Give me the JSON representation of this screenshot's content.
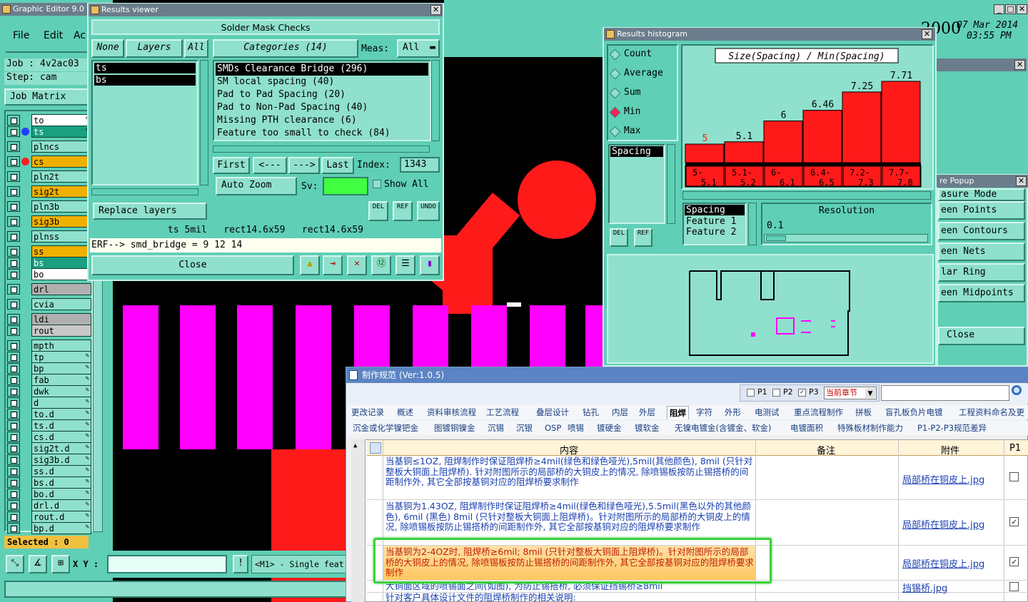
{
  "editor": {
    "title": "Graphic Editor 9.0",
    "menu": [
      "File",
      "Edit",
      "Ac"
    ],
    "job": "Job : 4v2ac03",
    "step": "Step: cam",
    "job_matrix": "Job Matrix ...",
    "selected": "Selected : 0",
    "xy_label": "X Y :",
    "msg": "<M1> - Single feat",
    "date": "07 Mar 2014",
    "time": "03:55 PM",
    "sheet_partial": "2000"
  },
  "layers": [
    "to",
    "ts",
    "plncs",
    "cs",
    "pln2t",
    "sig2t",
    "pln3b",
    "sig3b",
    "plnss",
    "ss",
    "bs",
    "bo",
    "drl",
    "cvia",
    "ldi",
    "rout",
    "mpth",
    "tp",
    "bp",
    "fab",
    "dwk",
    "d",
    "to.d",
    "ts.d",
    "cs.d",
    "sig2t.d",
    "sig3b.d",
    "ss.d",
    "bs.d",
    "bo.d",
    "drl.d",
    "rout.d",
    "bp.d"
  ],
  "results": {
    "title": "Results viewer",
    "heading": "Solder Mask Checks",
    "none": "None",
    "layers": "Layers",
    "all": "All",
    "layer_list": [
      "ts",
      "bs"
    ],
    "categories": "Categories (14)",
    "meas_label": "Meas:",
    "meas_value": "All",
    "cat_list": [
      "SMDs Clearance Bridge (296)",
      "SM local spacing (40)",
      "Pad to Pad Spacing (20)",
      "Pad to Non-Pad Spacing (40)",
      "Missing PTH clearance (6)",
      "Feature too small to check (84)"
    ],
    "first": "First",
    "prev": "<---",
    "next": "--->",
    "last": "Last",
    "index_label": "Index:",
    "index_value": "1343",
    "auto_zoom": "Auto Zoom",
    "sv_label": "Sv:",
    "show_all": "Show All",
    "replace_layers": "Replace layers",
    "del": "DEL",
    "ref": "REF",
    "undo": "UNDO",
    "info": "ts 5mil   rect14.6x59   rect14.6x59",
    "erf": "ERF--> smd_bridge = 9 12 14",
    "close": "Close"
  },
  "histogram": {
    "title": "Results histogram",
    "options": [
      "Count",
      "Average",
      "Sum",
      "Min",
      "Max"
    ],
    "selected_option": "Min",
    "list_item": "Spacing",
    "chart_title": "Size(Spacing) / Min(Spacing)",
    "metrics": [
      "Spacing",
      "Feature 1",
      "Feature 2"
    ],
    "resolution_label": "Resolution",
    "resolution_value": "0.1",
    "del": "DEL",
    "ref": "REF"
  },
  "chart_data": {
    "type": "bar",
    "title": "Size(Spacing) / Min(Spacing)",
    "categories": [
      "5-5.1",
      "5.1-5.2",
      "6-6.1",
      "6.4-6.5",
      "7.2-7.3",
      "7.7-7.8"
    ],
    "values": [
      5,
      5.1,
      6,
      6.46,
      7.25,
      7.71
    ],
    "value_labels": [
      "5",
      "5.1",
      "6",
      "6.46",
      "7.25",
      "7.71"
    ],
    "bin_labels": [
      [
        "5-",
        "5.1"
      ],
      [
        "5.1-",
        "5.2"
      ],
      [
        "6-",
        "6.1"
      ],
      [
        "6.4-",
        "6.5"
      ],
      [
        "7.2-",
        "7.3"
      ],
      [
        "7.7-",
        "7.8"
      ]
    ],
    "colors": {
      "bar": "#ff1a1a",
      "label": "#000000",
      "first_label": "#ff1a1a"
    }
  },
  "popup": {
    "title": "re Popup",
    "items": [
      "asure Mode",
      "een Points",
      "een Contours",
      "een Nets",
      "lar Ring",
      "een Midpoints"
    ],
    "close": "Close"
  },
  "spec": {
    "title": "制作规范 (Ver:1.0.5)",
    "checks": [
      "P1",
      "P2",
      "P3"
    ],
    "chapter": "当前章节",
    "tabs1": [
      "更改记录",
      "概述",
      "资料审核流程",
      "工艺流程",
      "叠层设计",
      "钻孔",
      "内层",
      "外层",
      "阻焊",
      "字符",
      "外形",
      "电测试",
      "重点流程制作",
      "拼板",
      "盲孔板负片电镀",
      "工程资料命名及更"
    ],
    "active_tab": "阻焊",
    "tabs2": [
      "沉金或化学镍钯金",
      "图镀铜镍金",
      "沉锡",
      "沉银",
      "OSP",
      "喷锡",
      "镀硬金",
      "镀软金",
      "无镍电镀金(含镀金、软金)",
      "电镀面积",
      "特殊板材制作能力",
      "P1-P2-P3规范差异"
    ],
    "columns": [
      "内容",
      "备注",
      "附件",
      "P1"
    ],
    "rows": [
      {
        "text": "当基铜≤1OZ, 阻焊制作时保证阻焊桥≥4mil(绿色和绿色哑光),5mil(其他颜色), 8mil (只针对整板大铜面上阻焊桥). 针对附图所示的局部桥的大铜皮上的情况, 除喷锡板按防止锡搭桥的间距制作外, 其它全部按基铜对应的阻焊桥要求制作",
        "file": "局部桥在铜皮上.jpg",
        "checked": false
      },
      {
        "text": "当基铜为1.43OZ, 阻焊制作时保证阻焊桥≥4mil(绿色和绿色哑光),5.5mil(黑色以外的其他颜色), 6mil (黑色) 8mil (只针对整板大铜面上阻焊桥)。针对附图所示的局部桥的大铜皮上的情况, 除喷锡板按防止锡搭桥的间距制作外, 其它全部按基铜对应的阻焊桥要求制作",
        "file": "局部桥在铜皮上.jpg",
        "checked": true
      },
      {
        "text": "当基铜为2-4OZ时, 阻焊桥≥6mil; 8mil (只针对整板大铜面上阻焊桥)。针对附图所示的局部桥的大铜皮上的情况, 除喷锡板按防止锡搭桥的间距制作外, 其它全部按基铜对应的阻焊桥要求制作",
        "file": "局部桥在铜皮上.jpg",
        "checked": true
      },
      {
        "text": "大铜面区域的喷锡面之间(如图), 为防止锡搭桥, 必须保证挡锡桥≥8mil",
        "file": "挡锡桥.jpg",
        "checked": false
      },
      {
        "text": "针对客户具体设计文件的阻焊桥制作的相关说明:",
        "file": "",
        "checked": false
      }
    ]
  }
}
